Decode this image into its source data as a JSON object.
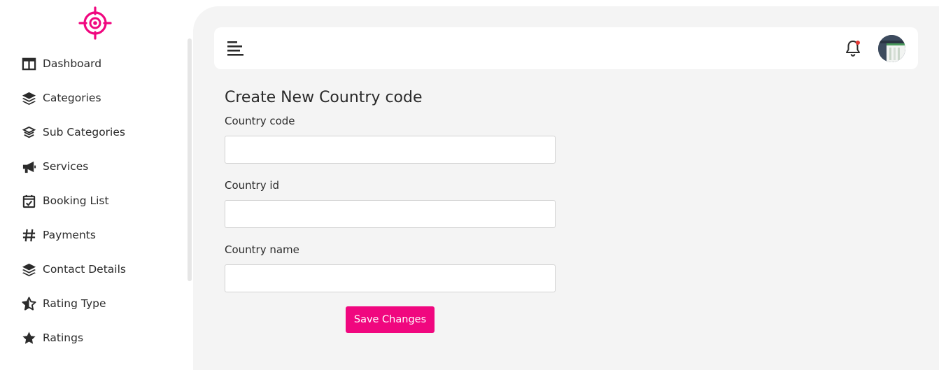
{
  "brand": {
    "accent": "#f0077f",
    "logo_icon": "crosshair-icon"
  },
  "sidebar": {
    "items": [
      {
        "label": "Dashboard",
        "icon": "columns-icon"
      },
      {
        "label": "Categories",
        "icon": "layers-icon"
      },
      {
        "label": "Sub Categories",
        "icon": "layers-small-icon"
      },
      {
        "label": "Services",
        "icon": "megaphone-icon"
      },
      {
        "label": "Booking List",
        "icon": "calendar-check-icon"
      },
      {
        "label": "Payments",
        "icon": "hashtag-icon"
      },
      {
        "label": "Contact Details",
        "icon": "layers-icon"
      },
      {
        "label": "Rating Type",
        "icon": "star-half-icon"
      },
      {
        "label": "Ratings",
        "icon": "star-icon"
      }
    ]
  },
  "topbar": {
    "menu_icon": "hamburger-icon",
    "notification_icon": "bell-icon",
    "avatar_icon": "avatar"
  },
  "form": {
    "title": "Create New Country code",
    "fields": [
      {
        "label": "Country code",
        "value": "",
        "placeholder": ""
      },
      {
        "label": "Country id",
        "value": "",
        "placeholder": ""
      },
      {
        "label": "Country name",
        "value": "",
        "placeholder": ""
      }
    ],
    "save_label": "Save Changes"
  }
}
